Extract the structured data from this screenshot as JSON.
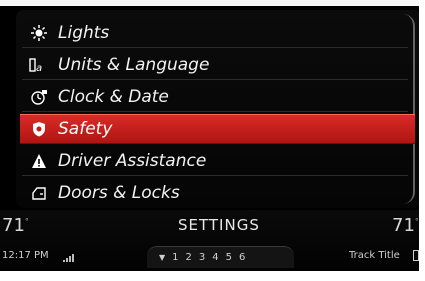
{
  "menu": {
    "items": [
      {
        "label": "Lights",
        "icon": "sun-icon"
      },
      {
        "label": "Units & Language",
        "icon": "units-language-icon"
      },
      {
        "label": "Clock & Date",
        "icon": "clock-icon"
      },
      {
        "label": "Safety",
        "icon": "shield-icon",
        "selected": true
      },
      {
        "label": "Driver Assistance",
        "icon": "warning-triangle-icon"
      },
      {
        "label": "Doors & Locks",
        "icon": "door-icon"
      }
    ]
  },
  "status": {
    "temp_left": "71",
    "temp_right": "71",
    "temp_unit": "°",
    "title": "SETTINGS",
    "time": "12:17 PM",
    "pages": [
      "1",
      "2",
      "3",
      "4",
      "5",
      "6"
    ],
    "track_title": "Track Title"
  },
  "colors": {
    "selected": "#c11d19",
    "background": "#000000",
    "text": "#f2f2f2"
  }
}
